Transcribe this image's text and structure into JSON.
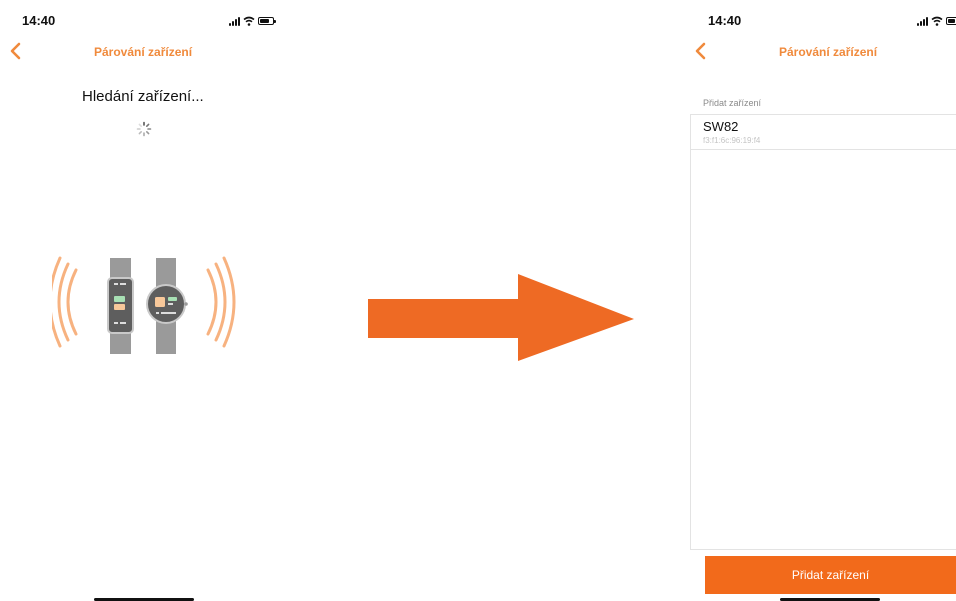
{
  "left": {
    "status_time": "14:40",
    "nav_title": "Párování zařízení",
    "searching_text": "Hledání zařízení..."
  },
  "right": {
    "status_time": "14:40",
    "nav_title": "Párování zařízení",
    "section_label": "Přidat zařízení",
    "devices": [
      {
        "name": "SW82",
        "mac": "f3:f1:6c:96:19:f4"
      }
    ],
    "add_button_label": "Přidat zařízení"
  },
  "colors": {
    "accent": "#f08a3c",
    "button": "#f26a1b",
    "arrow": "#ee6a24"
  },
  "icons": [
    "back-chevron-icon",
    "signal-icon",
    "wifi-icon",
    "battery-icon",
    "loading-spinner-icon",
    "pairing-illustration",
    "right-arrow-icon"
  ]
}
